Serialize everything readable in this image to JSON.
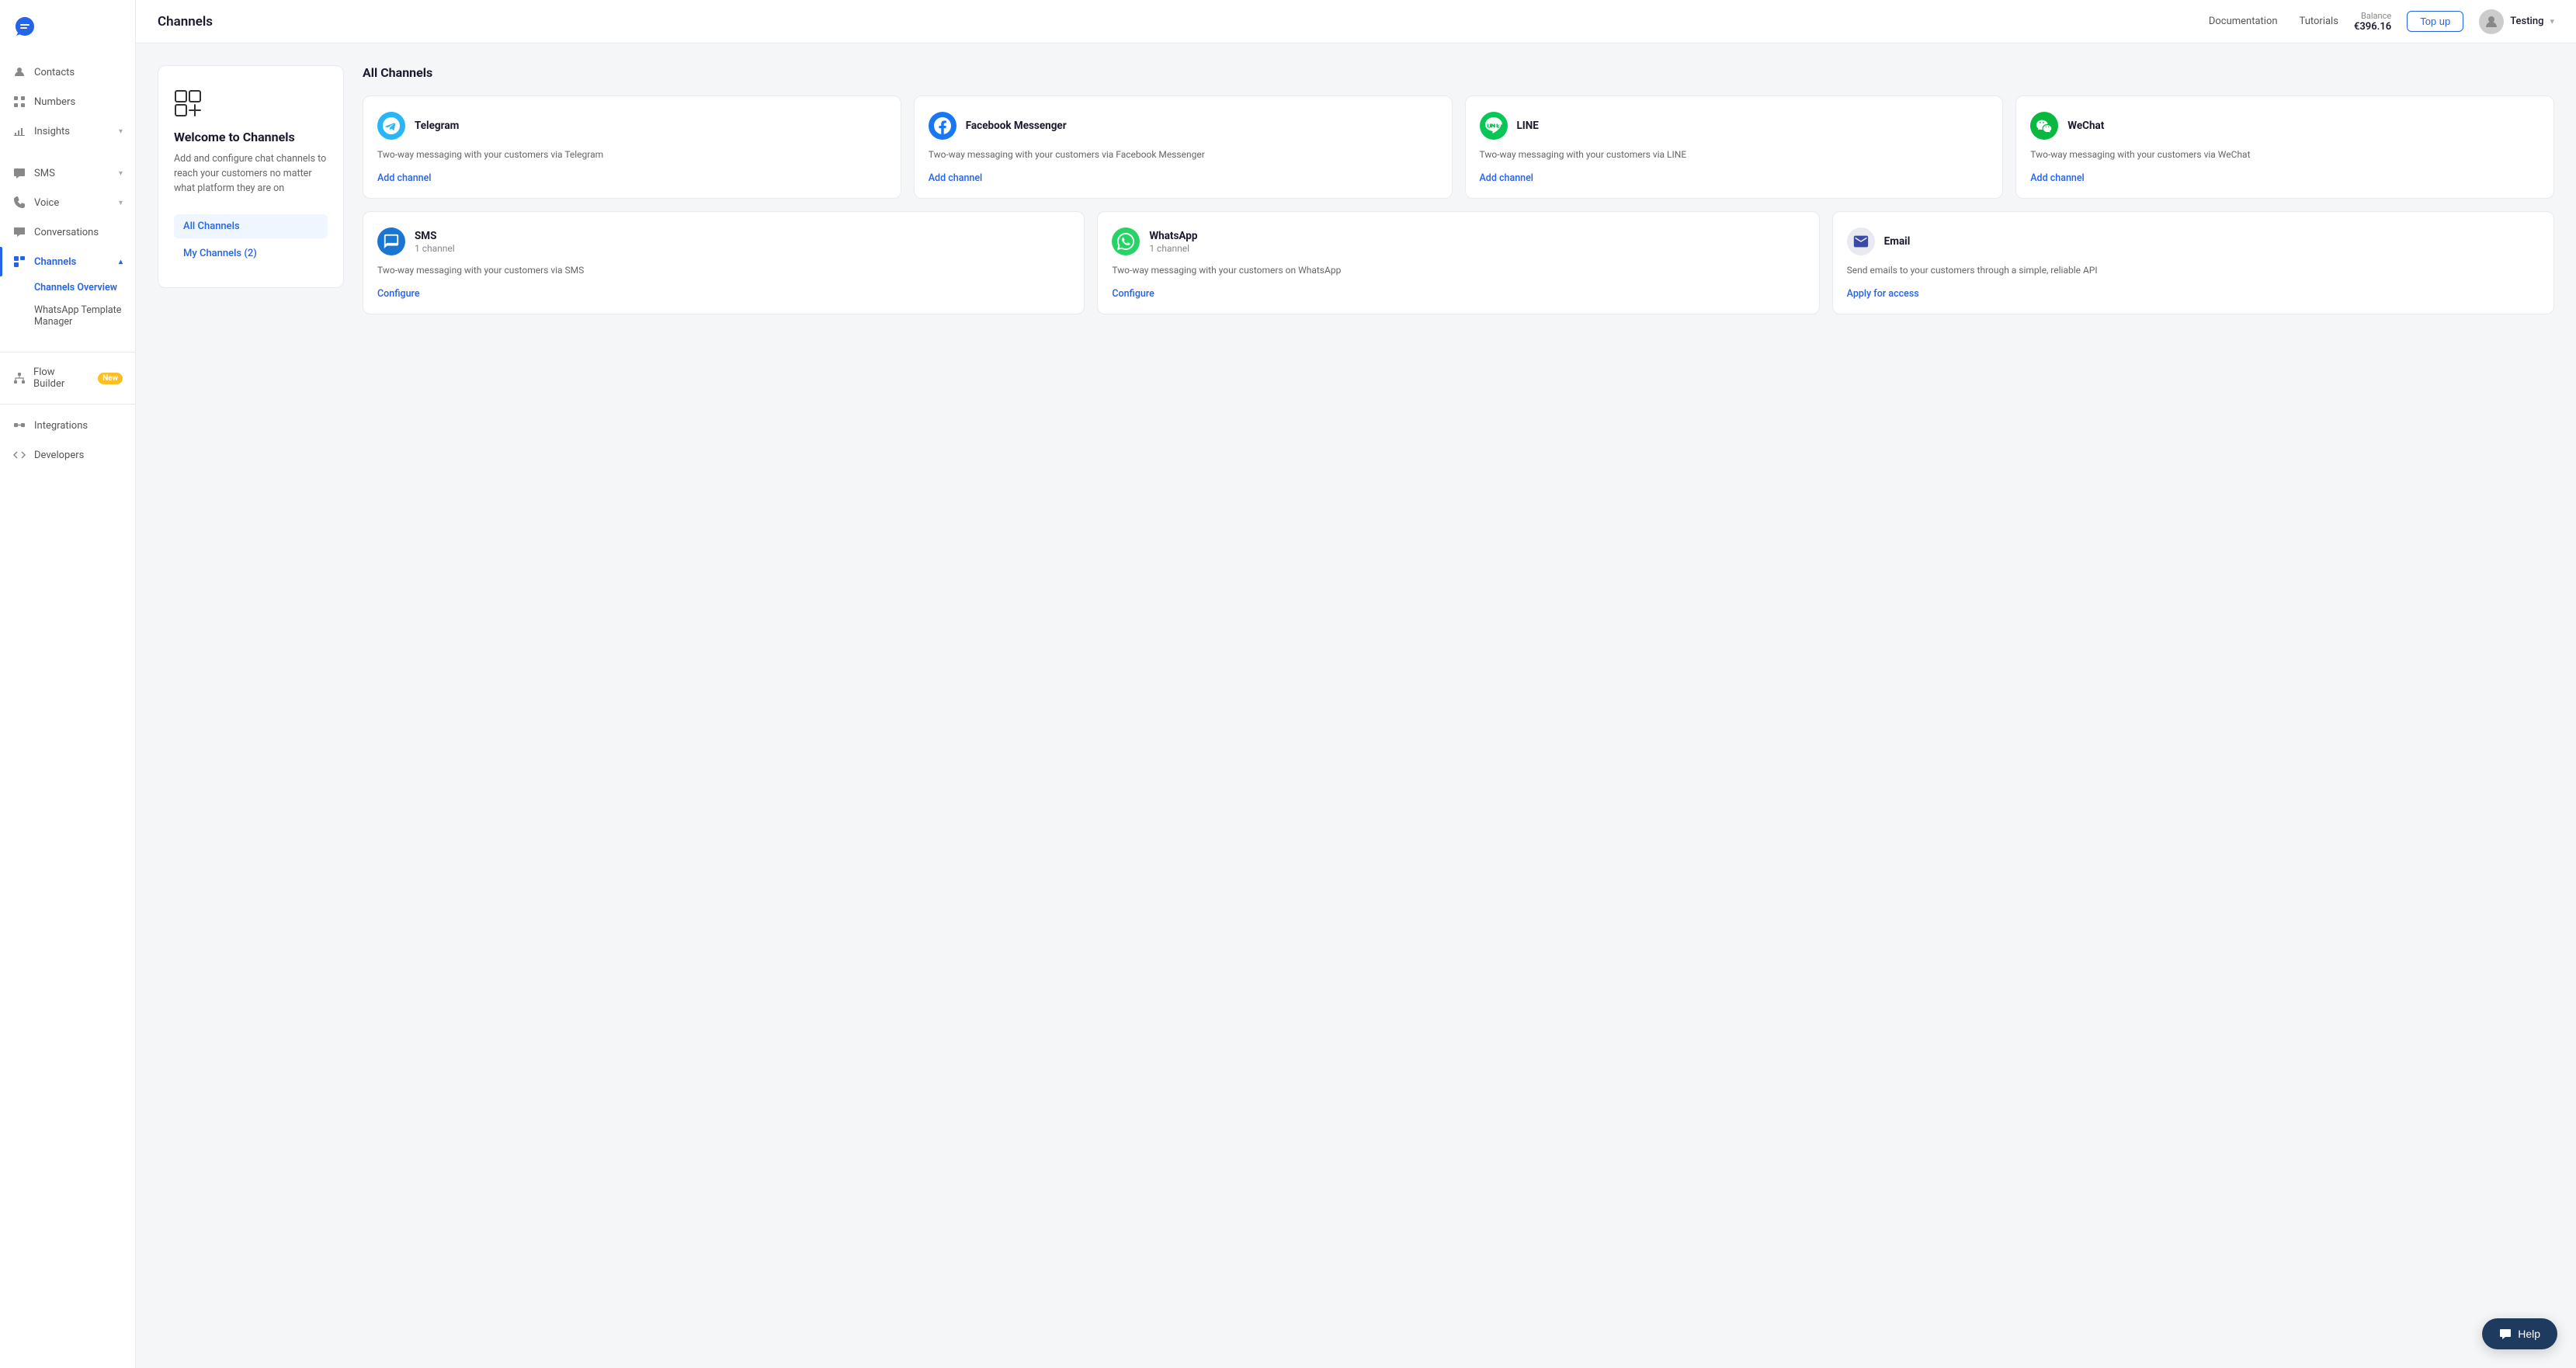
{
  "sidebar": {
    "logo_alt": "Bird logo",
    "nav_items": [
      {
        "id": "contacts",
        "label": "Contacts",
        "icon": "person",
        "active": false,
        "expandable": false
      },
      {
        "id": "numbers",
        "label": "Numbers",
        "icon": "grid",
        "active": false,
        "expandable": false
      },
      {
        "id": "insights",
        "label": "Insights",
        "icon": "chart",
        "active": false,
        "expandable": true
      },
      {
        "id": "sms",
        "label": "SMS",
        "icon": "message",
        "active": false,
        "expandable": true
      },
      {
        "id": "voice",
        "label": "Voice",
        "icon": "phone",
        "active": false,
        "expandable": true
      },
      {
        "id": "conversations",
        "label": "Conversations",
        "icon": "chat",
        "active": false,
        "expandable": false
      },
      {
        "id": "channels",
        "label": "Channels",
        "icon": "channels",
        "active": true,
        "expandable": true
      }
    ],
    "channels_sub": [
      {
        "id": "channels-overview",
        "label": "Channels Overview",
        "active": true
      },
      {
        "id": "whatsapp-template-manager",
        "label": "WhatsApp Template Manager",
        "active": false
      }
    ],
    "flow_builder": {
      "label": "Flow Builder",
      "badge": "New"
    },
    "integrations": {
      "label": "Integrations"
    },
    "developers": {
      "label": "Developers"
    }
  },
  "header": {
    "title": "Channels",
    "doc_link": "Documentation",
    "tutorials_link": "Tutorials",
    "balance_label": "Balance",
    "balance_amount": "€396.16",
    "top_up_label": "Top up",
    "user_name": "Testing"
  },
  "left_panel": {
    "icon_type": "grid-plus-icon",
    "title": "Welcome to Channels",
    "description": "Add and configure chat channels to reach your customers no matter what platform they are on",
    "nav_items": [
      {
        "id": "all-channels",
        "label": "All Channels",
        "active": true
      },
      {
        "id": "my-channels",
        "label": "My Channels (2)",
        "active": false
      }
    ]
  },
  "channels_panel": {
    "title": "All Channels",
    "row1": [
      {
        "id": "telegram",
        "name": "Telegram",
        "count": "",
        "description": "Two-way messaging with your customers via Telegram",
        "action": "Add channel",
        "logo_type": "telegram",
        "logo_emoji": "✈"
      },
      {
        "id": "facebook",
        "name": "Facebook Messenger",
        "count": "",
        "description": "Two-way messaging with your customers via Facebook Messenger",
        "action": "Add channel",
        "logo_type": "facebook",
        "logo_emoji": "💬"
      },
      {
        "id": "line",
        "name": "LINE",
        "count": "",
        "description": "Two-way messaging with your customers via LINE",
        "action": "Add channel",
        "logo_type": "line",
        "logo_emoji": "L"
      },
      {
        "id": "wechat",
        "name": "WeChat",
        "count": "",
        "description": "Two-way messaging with your customers via WeChat",
        "action": "Add channel",
        "logo_type": "wechat",
        "logo_emoji": "W"
      }
    ],
    "row2": [
      {
        "id": "sms",
        "name": "SMS",
        "count": "1 channel",
        "description": "Two-way messaging with your customers via SMS",
        "action": "Configure",
        "logo_type": "sms",
        "logo_emoji": "💬"
      },
      {
        "id": "whatsapp",
        "name": "WhatsApp",
        "count": "1 channel",
        "description": "Two-way messaging with your customers on WhatsApp",
        "action": "Configure",
        "logo_type": "whatsapp",
        "logo_emoji": "📱"
      },
      {
        "id": "email",
        "name": "Email",
        "count": "",
        "description": "Send emails to your customers through a simple, reliable API",
        "action": "Apply for access",
        "logo_type": "email",
        "logo_emoji": "✉"
      }
    ]
  },
  "help_button": {
    "label": "Help",
    "icon": "chat-icon"
  }
}
